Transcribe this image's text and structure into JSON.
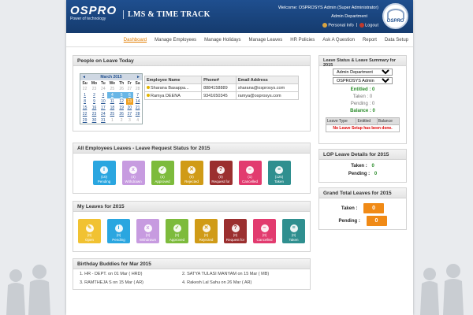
{
  "header": {
    "logo_main": "OSPRO",
    "logo_sub": "Power of technology",
    "app_title": "LMS & TIME TRACK",
    "welcome": "Welcome: OSPROSYS Admin (Super Administrator)",
    "department": "Admin Department",
    "personal_info": "Personal Info",
    "separator": "|",
    "logout": "Logout",
    "avatar_text": "OSPRO"
  },
  "nav": [
    "Dashboard",
    "Manage Employees",
    "Manage Holidays",
    "Manage Leaves",
    "HR Policies",
    "Ask A Question",
    "Report",
    "Data Setup"
  ],
  "people_on_leave": {
    "title": "People on Leave Today",
    "calendar": {
      "month": "March 2015",
      "prev": "◄",
      "next": "►",
      "days": [
        "Su",
        "Mo",
        "Tu",
        "We",
        "Th",
        "Fr",
        "Sa"
      ],
      "rows": [
        [
          "22",
          "23",
          "24",
          "25",
          "26",
          "27",
          "28"
        ],
        [
          "1",
          "2",
          "3",
          "4",
          "5",
          "6",
          "7"
        ],
        [
          "8",
          "9",
          "10",
          "11",
          "12",
          "13",
          "14"
        ],
        [
          "15",
          "16",
          "17",
          "18",
          "19",
          "20",
          "21"
        ],
        [
          "22",
          "23",
          "24",
          "25",
          "26",
          "27",
          "28"
        ],
        [
          "29",
          "30",
          "31",
          "1",
          "2",
          "3",
          "4"
        ]
      ]
    },
    "columns": [
      "Employee Name",
      "Phone#",
      "Email Address"
    ],
    "rows": [
      [
        "Sharana Basappa...",
        "8884158889",
        "sharana@osprosys.com"
      ],
      [
        "Ramya DEENA",
        "9341650345",
        "ramya@osprosys.com"
      ]
    ]
  },
  "all_leaves": {
    "title": "All Employees Leaves - Leave Request Status for 2015",
    "tiles": [
      {
        "count": "(10)",
        "label": "Pending",
        "color": "#2aa6e0",
        "icon": "i"
      },
      {
        "count": "(4)",
        "label": "Withdrawn",
        "color": "#c79be0",
        "icon": "x"
      },
      {
        "count": "(4)",
        "label": "Approved",
        "color": "#7dbb3c",
        "icon": "✓"
      },
      {
        "count": "(0)",
        "label": "Rejected",
        "color": "#d09b17",
        "icon": "✕"
      },
      {
        "count": "(0)",
        "label": "Request for",
        "color": "#9b2f2f",
        "icon": "?"
      },
      {
        "count": "(1)",
        "label": "Cancelled",
        "color": "#e23b6f",
        "icon": "–"
      },
      {
        "count": "(125)",
        "label": "Taken",
        "color": "#2f8f8f",
        "icon": "≡"
      }
    ]
  },
  "my_leaves": {
    "title": "My Leaves for 2015",
    "tiles": [
      {
        "count": "(0)",
        "label": "Open",
        "color": "#f1c232",
        "icon": "✎"
      },
      {
        "count": "(0)",
        "label": "Pending",
        "color": "#2aa6e0",
        "icon": "i"
      },
      {
        "count": "(0)",
        "label": "Withdrawn",
        "color": "#c79be0",
        "icon": "x"
      },
      {
        "count": "(0)",
        "label": "Approved",
        "color": "#7dbb3c",
        "icon": "✓"
      },
      {
        "count": "(0)",
        "label": "Rejected",
        "color": "#d09b17",
        "icon": "✕"
      },
      {
        "count": "(0)",
        "label": "Request for",
        "color": "#9b2f2f",
        "icon": "?"
      },
      {
        "count": "(0)",
        "label": "Cancelled",
        "color": "#e23b6f",
        "icon": "–"
      },
      {
        "count": "(0)",
        "label": "Taken",
        "color": "#2f8f8f",
        "icon": "≡"
      }
    ]
  },
  "birthday": {
    "title": "Birthday Buddies for Mar 2015",
    "entries": [
      "1.  HR - DEPT. on 01 Mar ( HRD)",
      "2.  SATYA TULASI MANYAM on 15 Mar ( MB)",
      "3.  RAMTHEJA S on 15 Mar ( AR)",
      "4.  Rakesh Lal Sahu on 26 Mar ( AR)"
    ]
  },
  "leave_summary": {
    "title": "Leave Status & Leave Summary for 2015",
    "department_select": "Admin Department",
    "user_select": "OSPROSYS Admin",
    "entitled": "Entitled : 0",
    "taken": "Taken : 0",
    "pending": "Pending : 0",
    "balance": "Balance : 0",
    "table_cols": [
      "Leave Type",
      "Entitled",
      "Balance"
    ],
    "empty_msg": "No Leave Setup has been done."
  },
  "lop": {
    "title": "LOP Leave Details for 2015",
    "taken": "Taken :",
    "taken_val": "0",
    "pending": "Pending :",
    "pending_val": "0"
  },
  "grand_total": {
    "title": "Grand Total Leaves for 2015",
    "taken": "Taken :",
    "taken_val": "0",
    "pending": "Pending :",
    "pending_val": "0"
  }
}
